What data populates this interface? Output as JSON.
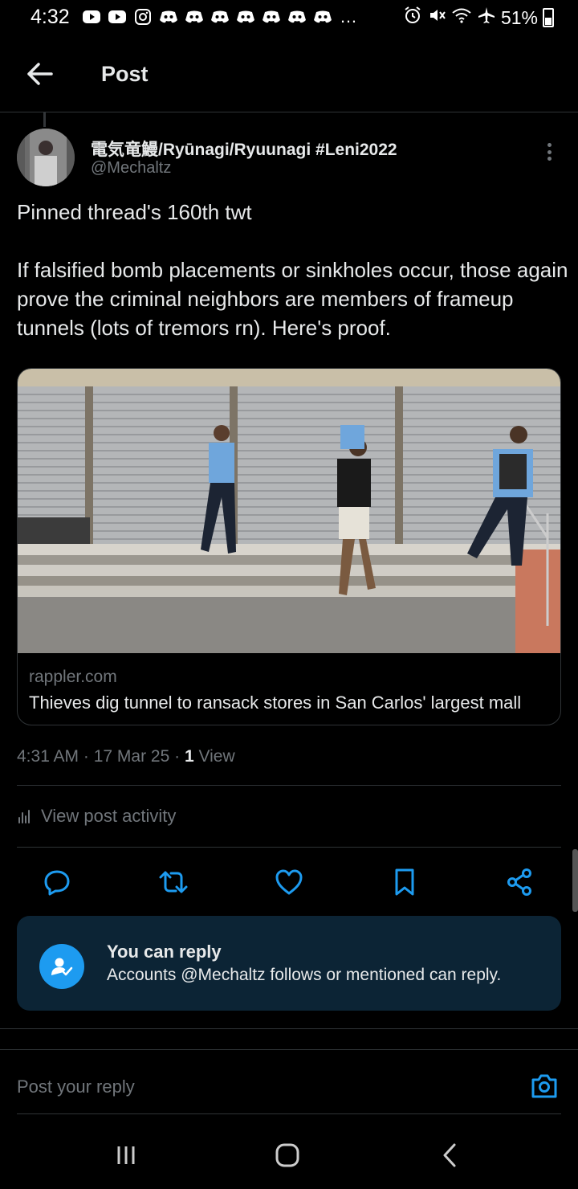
{
  "status_bar": {
    "time": "4:32",
    "battery": "51%",
    "overflow": "…",
    "left_icons": [
      "youtube-icon",
      "youtube-icon",
      "instagram-icon",
      "discord-icon",
      "discord-icon",
      "discord-icon",
      "discord-icon",
      "discord-icon",
      "discord-icon",
      "discord-icon"
    ],
    "right_icons": [
      "alarm-icon",
      "mute-icon",
      "wifi-icon",
      "airplane-icon"
    ]
  },
  "header": {
    "title": "Post"
  },
  "post": {
    "author": {
      "display_name": "電気竜鰻/Ryūnagi/Ryuunagi #Leni2022",
      "handle": "@Mechaltz"
    },
    "text_lines": [
      "Pinned thread's 160th twt",
      "If falsified bomb placements or sinkholes occur, those again prove the criminal neighbors are members of frameup tunnels (lots of tremors rn). Here's proof."
    ],
    "link_card": {
      "domain": "rappler.com",
      "title": "Thieves dig tunnel to ransack stores in San Carlos' largest mall"
    },
    "meta": {
      "time": "4:31 AM",
      "date": "17 Mar 25",
      "views_count": "1",
      "views_label": "View"
    },
    "activity_label": "View post activity"
  },
  "reply_settings": {
    "title": "You can reply",
    "subtitle": "Accounts @Mechaltz follows or mentioned can reply."
  },
  "composer": {
    "placeholder": "Post your reply"
  },
  "colors": {
    "background": "#000000",
    "accent": "#1d9bf0",
    "secondary_text": "#71767b",
    "banner_bg": "#0c2435"
  }
}
